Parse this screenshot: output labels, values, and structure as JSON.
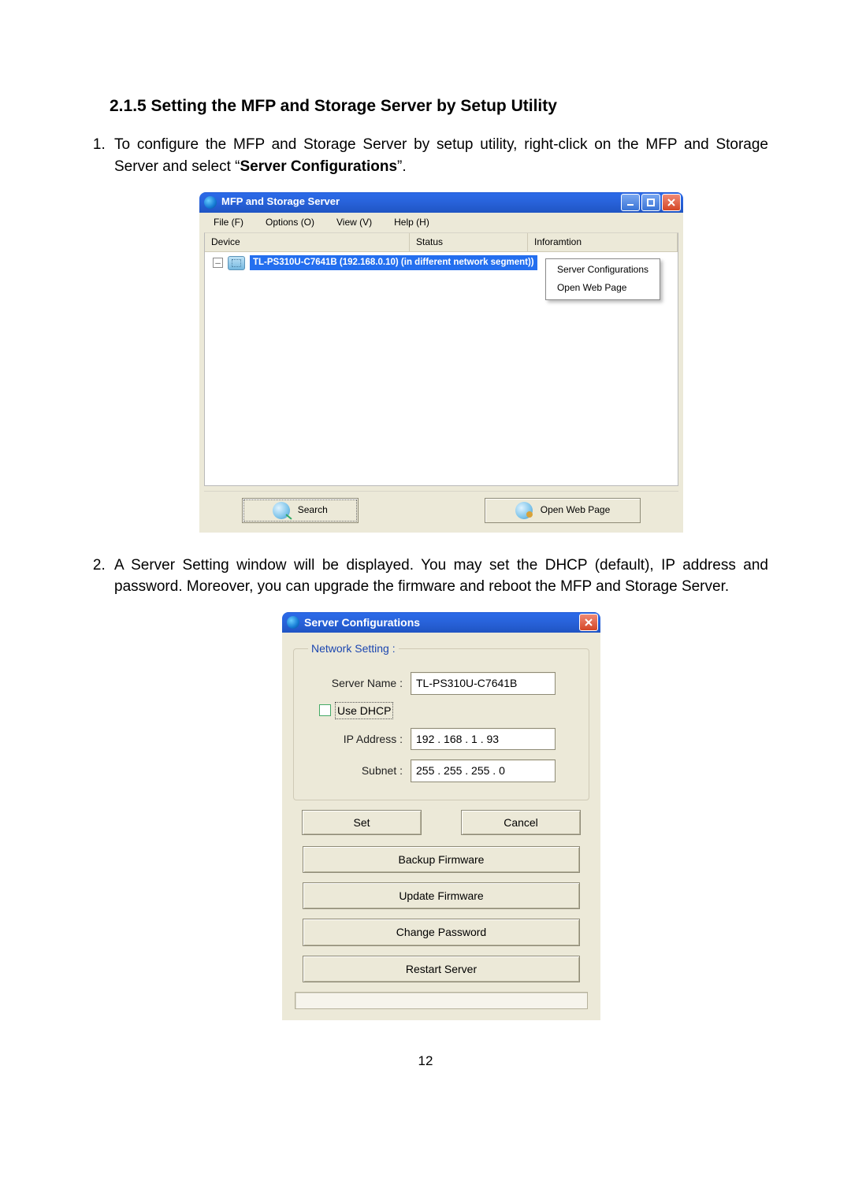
{
  "heading": "2.1.5  Setting the MFP and Storage Server by Setup Utility",
  "steps": {
    "one_pre": "To configure the MFP and Storage Server by setup utility, right-click on the MFP and Storage Server and select “",
    "one_bold": "Server Configurations",
    "one_post": "”.",
    "two": "A Server Setting window will be displayed. You may set the DHCP (default), IP address and password. Moreover, you can upgrade the firmware and reboot the MFP and Storage Server."
  },
  "page_number": "12",
  "win1": {
    "title": "MFP and Storage Server",
    "menu": {
      "file": "File (F)",
      "options": "Options (O)",
      "view": "View (V)",
      "help": "Help (H)"
    },
    "columns": {
      "device": "Device",
      "status": "Status",
      "info": "Inforamtion"
    },
    "tree_toggle": "–",
    "device_highlight": "TL-PS310U-C7641B  (192.168.0.10) (in different network segment))",
    "ctx": {
      "srvcfg": "Server Configurations",
      "openweb": "Open Web Page"
    },
    "buttons": {
      "search": "Search",
      "openweb": "Open Web Page"
    }
  },
  "dlg": {
    "title": "Server Configurations",
    "legend": "Network Setting :",
    "labels": {
      "server_name": "Server Name :",
      "use_dhcp": "Use DHCP",
      "ip": "IP Address :",
      "subnet": "Subnet :"
    },
    "values": {
      "server_name": "TL-PS310U-C7641B",
      "ip": "192 . 168 .   1   .  93",
      "subnet": "255 . 255 . 255 .   0"
    },
    "buttons": {
      "set": "Set",
      "cancel": "Cancel",
      "backup": "Backup Firmware",
      "update": "Update Firmware",
      "changepw": "Change Password",
      "restart": "Restart Server"
    }
  }
}
